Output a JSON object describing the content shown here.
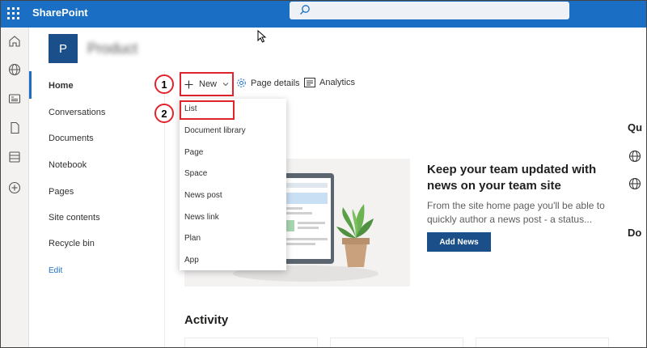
{
  "suite": {
    "app_name": "SharePoint"
  },
  "site": {
    "logo_letter": "P",
    "name": "Product"
  },
  "nav": {
    "items": [
      {
        "label": "Home"
      },
      {
        "label": "Conversations"
      },
      {
        "label": "Documents"
      },
      {
        "label": "Notebook"
      },
      {
        "label": "Pages"
      },
      {
        "label": "Site contents"
      },
      {
        "label": "Recycle bin"
      }
    ],
    "edit_label": "Edit"
  },
  "command_bar": {
    "new_label": "New",
    "page_details_label": "Page details",
    "analytics_label": "Analytics"
  },
  "new_menu": {
    "items": [
      {
        "label": "List"
      },
      {
        "label": "Document library"
      },
      {
        "label": "Page"
      },
      {
        "label": "Space"
      },
      {
        "label": "News post"
      },
      {
        "label": "News link"
      },
      {
        "label": "Plan"
      },
      {
        "label": "App"
      }
    ]
  },
  "annotations": {
    "step1": "1",
    "step2": "2"
  },
  "news": {
    "title": "Keep your team updated with news on your team site",
    "text": "From the site home page you'll be able to quickly author a news post - a status...",
    "button_label": "Add News"
  },
  "activity": {
    "heading": "Activity"
  },
  "right_panel": {
    "heading1": "Qu",
    "heading2": "Do"
  },
  "colors": {
    "suite_bar": "#1a6fc4",
    "site_logo": "#1b4f8a",
    "annotation": "#e0242c"
  }
}
